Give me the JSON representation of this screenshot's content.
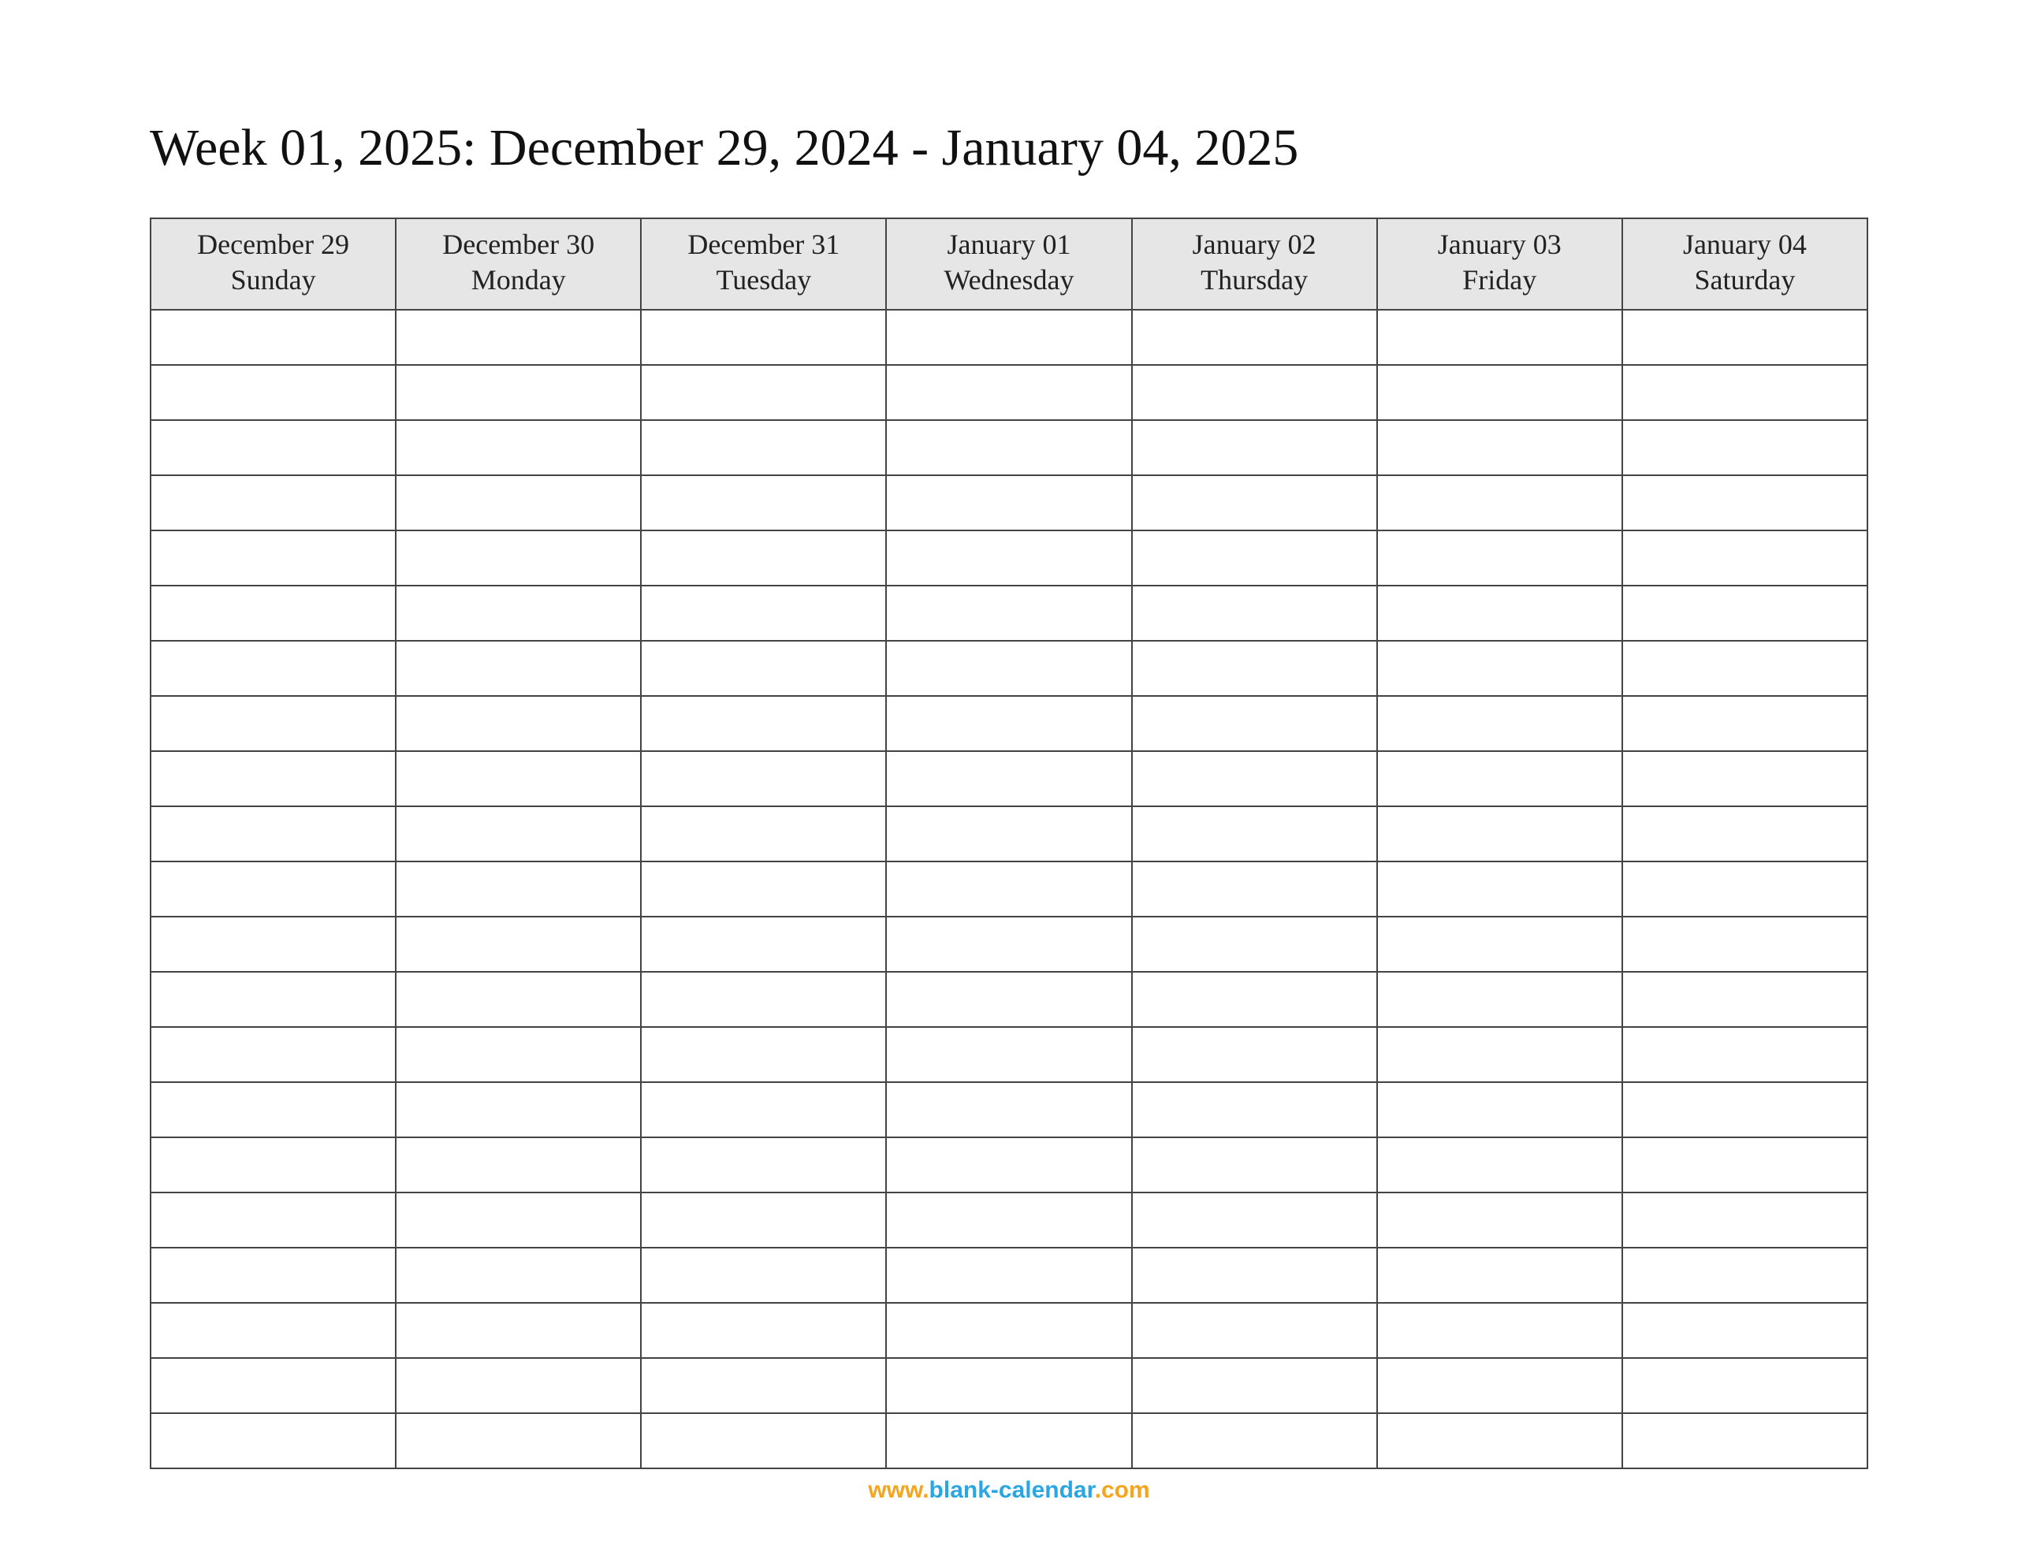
{
  "title": "Week 01, 2025: December 29, 2024 - January 04, 2025",
  "columns": [
    {
      "date": "December 29",
      "day": "Sunday"
    },
    {
      "date": "December 30",
      "day": "Monday"
    },
    {
      "date": "December 31",
      "day": "Tuesday"
    },
    {
      "date": "January 01",
      "day": "Wednesday"
    },
    {
      "date": "January 02",
      "day": "Thursday"
    },
    {
      "date": "January 03",
      "day": "Friday"
    },
    {
      "date": "January 04",
      "day": "Saturday"
    }
  ],
  "row_count": 21,
  "footer": {
    "part1": "www.",
    "part2": "blank-calendar",
    "part3": ".com"
  }
}
